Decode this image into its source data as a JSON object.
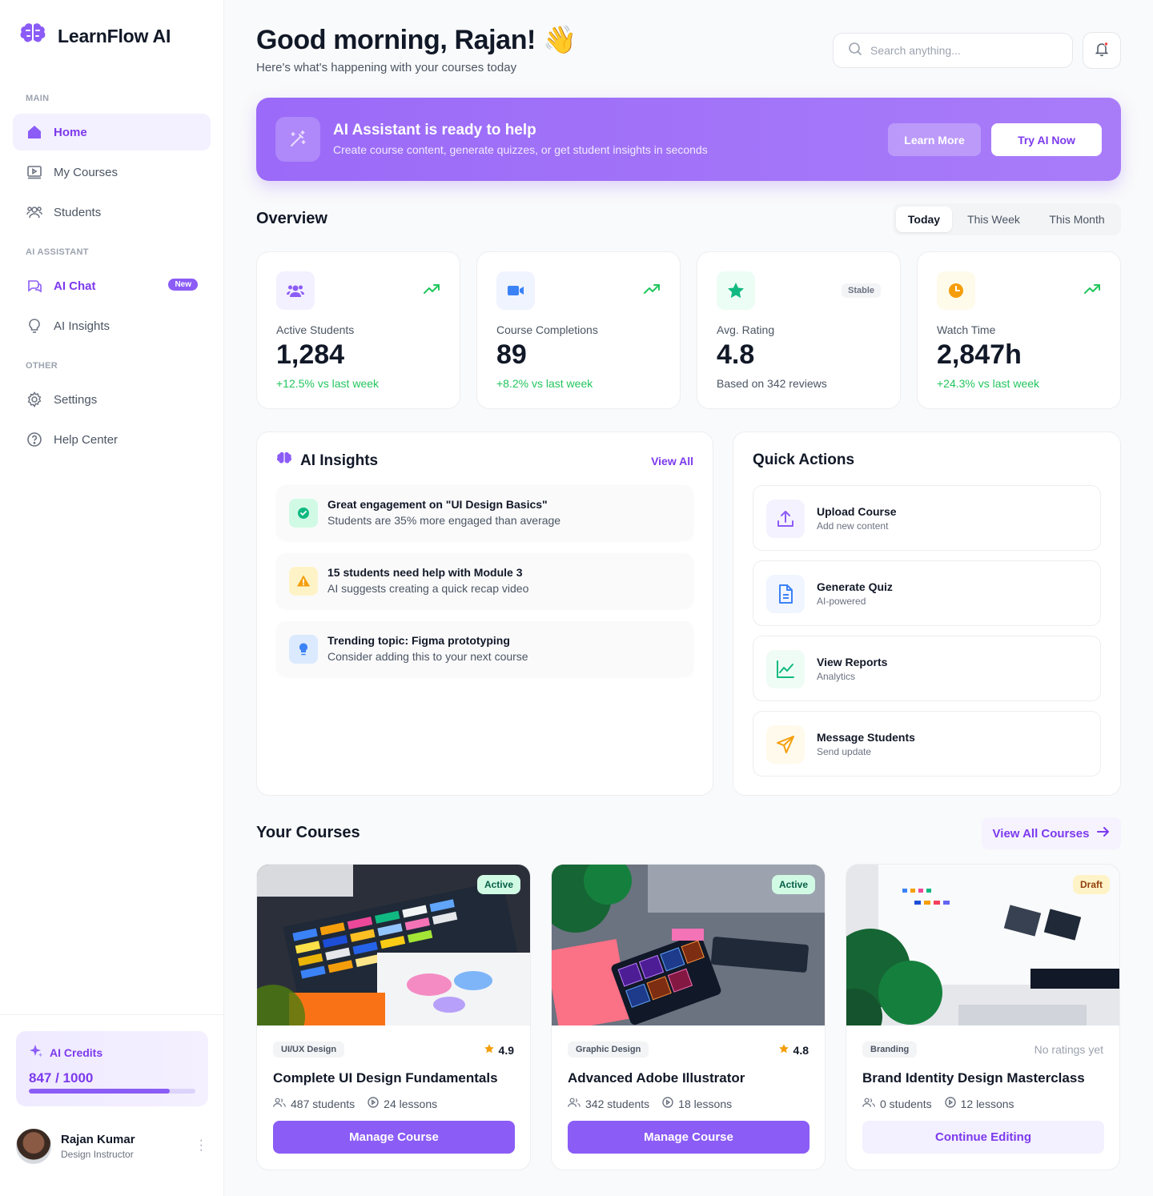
{
  "brand": {
    "name": "LearnFlow AI",
    "color": "#8b5cf6"
  },
  "sidebar": {
    "sections": [
      "MAIN",
      "AI ASSISTANT",
      "OTHER"
    ],
    "items": [
      {
        "label": "Home",
        "icon": "home-icon"
      },
      {
        "label": "My Courses",
        "icon": "video-icon"
      },
      {
        "label": "Students",
        "icon": "users-icon"
      },
      {
        "label": "AI Chat",
        "icon": "chat-icon",
        "badge": "New"
      },
      {
        "label": "AI Insights",
        "icon": "lightbulb-icon"
      },
      {
        "label": "Settings",
        "icon": "gear-icon"
      },
      {
        "label": "Help Center",
        "icon": "help-icon"
      }
    ],
    "credits": {
      "title": "AI Credits",
      "value": "847 / 1000",
      "fraction": 0.847
    },
    "user": {
      "name": "Rajan Kumar",
      "role": "Design Instructor"
    }
  },
  "header": {
    "greeting": "Good morning, Rajan! 👋",
    "subtitle": "Here's what's happening with your courses today",
    "search_placeholder": "Search anything..."
  },
  "banner": {
    "title": "AI Assistant is ready to help",
    "subtitle": "Create course content, generate quizzes, or get student insights in seconds",
    "learn_more": "Learn More",
    "try_now": "Try AI Now"
  },
  "overview": {
    "title": "Overview",
    "tabs": [
      "Today",
      "This Week",
      "This Month"
    ],
    "stats": [
      {
        "label": "Active Students",
        "value": "1,284",
        "change": "+12.5% vs last week",
        "icon": "users-icon"
      },
      {
        "label": "Course Completions",
        "value": "89",
        "change": "+8.2% vs last week",
        "icon": "video-icon"
      },
      {
        "label": "Avg. Rating",
        "value": "4.8",
        "change": "Based on 342 reviews",
        "badge": "Stable",
        "icon": "star-icon"
      },
      {
        "label": "Watch Time",
        "value": "2,847h",
        "change": "+24.3% vs last week",
        "icon": "clock-icon"
      }
    ]
  },
  "insights": {
    "title": "AI Insights",
    "view_all": "View All",
    "items": [
      {
        "title": "Great engagement on \"UI Design Basics\"",
        "subtitle": "Students are 35% more engaged than average",
        "icon": "check-icon"
      },
      {
        "title": "15 students need help with Module 3",
        "subtitle": "AI suggests creating a quick recap video",
        "icon": "warning-icon"
      },
      {
        "title": "Trending topic: Figma prototyping",
        "subtitle": "Consider adding this to your next course",
        "icon": "lightbulb-icon"
      }
    ]
  },
  "quick_actions": {
    "title": "Quick Actions",
    "items": [
      {
        "title": "Upload Course",
        "subtitle": "Add new content",
        "icon": "upload-icon"
      },
      {
        "title": "Generate Quiz",
        "subtitle": "AI-powered",
        "icon": "document-icon"
      },
      {
        "title": "View Reports",
        "subtitle": "Analytics",
        "icon": "chart-icon"
      },
      {
        "title": "Message Students",
        "subtitle": "Send update",
        "icon": "send-icon"
      }
    ]
  },
  "courses": {
    "title": "Your Courses",
    "view_all": "View All Courses",
    "items": [
      {
        "status": "Active",
        "category": "UI/UX Design",
        "rating": "4.9",
        "title": "Complete UI Design Fundamentals",
        "students": "487 students",
        "lessons": "24 lessons",
        "button": "Manage Course"
      },
      {
        "status": "Active",
        "category": "Graphic Design",
        "rating": "4.8",
        "title": "Advanced Adobe Illustrator",
        "students": "342 students",
        "lessons": "18 lessons",
        "button": "Manage Course"
      },
      {
        "status": "Draft",
        "category": "Branding",
        "rating": "No ratings yet",
        "title": "Brand Identity Design Masterclass",
        "students": "0 students",
        "lessons": "12 lessons",
        "button": "Continue Editing"
      }
    ]
  }
}
